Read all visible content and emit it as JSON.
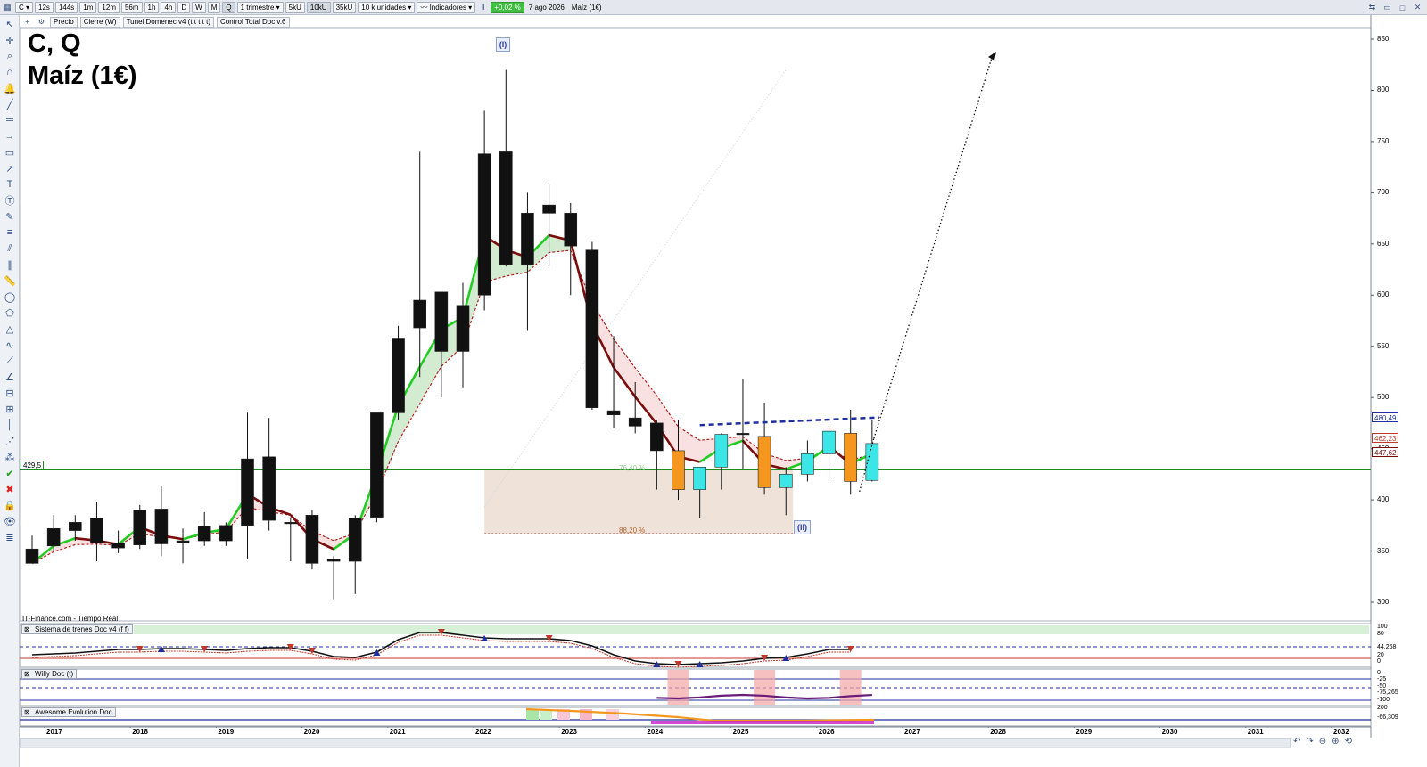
{
  "toolbar": {
    "symbol": "C",
    "periods": [
      "12s",
      "144s",
      "1m",
      "12m",
      "56m",
      "1h",
      "4h",
      "D",
      "W",
      "M",
      "Q"
    ],
    "period_selected": "Q",
    "range": "1 trimestre",
    "units": [
      "5kU",
      "10kU",
      "35kU"
    ],
    "units_selected": "10kU",
    "units_label": "10 k unidades",
    "indicators_label": "Indicadores",
    "change_pct": "+0,02 %",
    "date": "7 ago 2026",
    "instrument": "Maíz (1€)"
  },
  "subbar": {
    "tabs": [
      "Precio",
      "Cierre (W)",
      "Tunel Domenec v4 (t t t t t)",
      "Control Total Doc v.6"
    ]
  },
  "chart": {
    "title_line1": "C, Q",
    "title_line2": "Maíz (1€)",
    "source": "IT-Finance.com - Tiempo Real",
    "wave_label_1": "(I)",
    "wave_label_2": "(II)",
    "fib_1": "76,40 %",
    "fib_2": "88,20 %",
    "hline_label": "429,5",
    "price_badges": [
      "480,49",
      "462,23",
      "447,62"
    ],
    "y_ticks": [
      "850",
      "800",
      "750",
      "700",
      "650",
      "600",
      "550",
      "500",
      "450",
      "400",
      "350",
      "300"
    ],
    "x_ticks": [
      "2017",
      "2018",
      "2019",
      "2020",
      "2021",
      "2022",
      "2023",
      "2024",
      "2025",
      "2026",
      "2027",
      "2028",
      "2029",
      "2030",
      "2031",
      "2032"
    ],
    "colors": {
      "bull": "#111111",
      "bear": "#111111",
      "orange": "#f5961e",
      "cyan": "#3ce6e6",
      "green_line": "#22cc22",
      "red_line": "#7a0c0c",
      "hline": "#1e8a1e"
    }
  },
  "chart_data": {
    "type": "candlestick",
    "xlabel": "",
    "ylabel": "",
    "ylim": [
      280,
      860
    ],
    "categories": [
      "2016Q4",
      "2017Q1",
      "2017Q2",
      "2017Q3",
      "2017Q4",
      "2018Q1",
      "2018Q2",
      "2018Q3",
      "2018Q4",
      "2019Q1",
      "2019Q2",
      "2019Q3",
      "2019Q4",
      "2020Q1",
      "2020Q2",
      "2020Q3",
      "2020Q4",
      "2021Q1",
      "2021Q2",
      "2021Q3",
      "2021Q4",
      "2022Q1",
      "2022Q2",
      "2022Q3",
      "2022Q4",
      "2023Q1",
      "2023Q2",
      "2023Q3",
      "2023Q4",
      "2024Q1",
      "2024Q2",
      "2024Q3",
      "2024Q4",
      "2025Q1",
      "2025Q2",
      "2025Q3",
      "2025Q4",
      "2026Q1",
      "2026Q2"
    ],
    "candles": [
      {
        "o": 352,
        "h": 365,
        "l": 338,
        "c": 338,
        "style": "black"
      },
      {
        "o": 355,
        "h": 385,
        "l": 350,
        "c": 372,
        "style": "black"
      },
      {
        "o": 378,
        "h": 385,
        "l": 360,
        "c": 370,
        "style": "black"
      },
      {
        "o": 382,
        "h": 398,
        "l": 340,
        "c": 358,
        "style": "black"
      },
      {
        "o": 358,
        "h": 370,
        "l": 348,
        "c": 353,
        "style": "black"
      },
      {
        "o": 356,
        "h": 395,
        "l": 352,
        "c": 390,
        "style": "black"
      },
      {
        "o": 391,
        "h": 413,
        "l": 345,
        "c": 357,
        "style": "black"
      },
      {
        "o": 360,
        "h": 372,
        "l": 338,
        "c": 358,
        "style": "black"
      },
      {
        "o": 360,
        "h": 388,
        "l": 355,
        "c": 374,
        "style": "black"
      },
      {
        "o": 360,
        "h": 378,
        "l": 355,
        "c": 375,
        "style": "black"
      },
      {
        "o": 375,
        "h": 485,
        "l": 342,
        "c": 440,
        "style": "black"
      },
      {
        "o": 442,
        "h": 480,
        "l": 370,
        "c": 380,
        "style": "black"
      },
      {
        "o": 378,
        "h": 383,
        "l": 340,
        "c": 378,
        "style": "black"
      },
      {
        "o": 385,
        "h": 390,
        "l": 332,
        "c": 338,
        "style": "black"
      },
      {
        "o": 340,
        "h": 345,
        "l": 303,
        "c": 342,
        "style": "black"
      },
      {
        "o": 340,
        "h": 385,
        "l": 308,
        "c": 382,
        "style": "black"
      },
      {
        "o": 383,
        "h": 478,
        "l": 378,
        "c": 485,
        "style": "black"
      },
      {
        "o": 485,
        "h": 570,
        "l": 478,
        "c": 558,
        "style": "black"
      },
      {
        "o": 595,
        "h": 740,
        "l": 520,
        "c": 568,
        "style": "black"
      },
      {
        "o": 545,
        "h": 590,
        "l": 500,
        "c": 603,
        "style": "black"
      },
      {
        "o": 545,
        "h": 612,
        "l": 510,
        "c": 590,
        "style": "black"
      },
      {
        "o": 600,
        "h": 780,
        "l": 585,
        "c": 738,
        "style": "black"
      },
      {
        "o": 740,
        "h": 820,
        "l": 628,
        "c": 630,
        "style": "black"
      },
      {
        "o": 680,
        "h": 700,
        "l": 565,
        "c": 630,
        "style": "black"
      },
      {
        "o": 688,
        "h": 708,
        "l": 628,
        "c": 680,
        "style": "black"
      },
      {
        "o": 680,
        "h": 690,
        "l": 600,
        "c": 648,
        "style": "black"
      },
      {
        "o": 644,
        "h": 652,
        "l": 488,
        "c": 490,
        "style": "black"
      },
      {
        "o": 483,
        "h": 560,
        "l": 470,
        "c": 487,
        "style": "black"
      },
      {
        "o": 480,
        "h": 515,
        "l": 465,
        "c": 472,
        "style": "black"
      },
      {
        "o": 475,
        "h": 478,
        "l": 410,
        "c": 448,
        "style": "black"
      },
      {
        "o": 448,
        "h": 478,
        "l": 400,
        "c": 410,
        "style": "orange"
      },
      {
        "o": 410,
        "h": 432,
        "l": 382,
        "c": 432,
        "style": "cyan"
      },
      {
        "o": 432,
        "h": 465,
        "l": 410,
        "c": 464,
        "style": "cyan"
      },
      {
        "o": 465,
        "h": 518,
        "l": 430,
        "c": 465,
        "style": "black"
      },
      {
        "o": 462,
        "h": 495,
        "l": 405,
        "c": 412,
        "style": "orange"
      },
      {
        "o": 412,
        "h": 432,
        "l": 385,
        "c": 425,
        "style": "cyan"
      },
      {
        "o": 425,
        "h": 458,
        "l": 418,
        "c": 445,
        "style": "cyan"
      },
      {
        "o": 445,
        "h": 472,
        "l": 420,
        "c": 467,
        "style": "cyan"
      },
      {
        "o": 465,
        "h": 488,
        "l": 405,
        "c": 418,
        "style": "orange"
      },
      {
        "o": 419,
        "h": 478,
        "l": 418,
        "c": 455,
        "style": "cyan"
      }
    ],
    "annotations": {
      "horizontal_line": 429.5,
      "fib_levels": [
        {
          "label": "76,40 %",
          "value": 429.5
        },
        {
          "label": "88,20 %",
          "value": 367
        }
      ],
      "price_badges": [
        480.49,
        462.23,
        447.62
      ]
    }
  },
  "panels": {
    "p1_title": "Sistema de trenes Doc v4 (f f)",
    "p1_ticks": [
      "100",
      "80",
      "44,268",
      "20",
      "0"
    ],
    "p2_title": "Willy Doc (t)",
    "p2_ticks": [
      "0",
      "-25",
      "-50",
      "-75,265",
      "-100"
    ],
    "p3_title": "Awesome Evolution Doc",
    "p3_ticks": [
      "200",
      "-66,309"
    ]
  }
}
